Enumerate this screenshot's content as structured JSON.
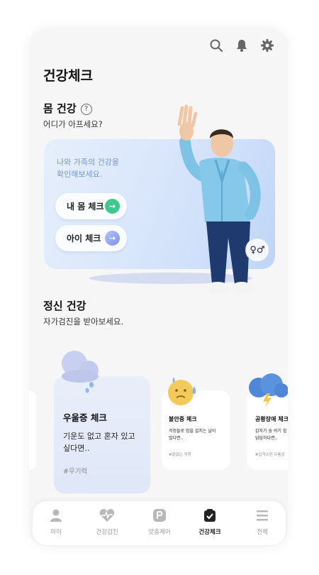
{
  "header": {
    "title": "건강체크",
    "icons": [
      "search-icon",
      "bell-icon",
      "gear-icon"
    ]
  },
  "body_health": {
    "title": "몸 건강",
    "help": "?",
    "subtitle": "어디가 아프세요?",
    "card_desc_line1": "나와 가족의 건강을",
    "card_desc_line2": "확인해보세요.",
    "my_check_label": "내 몸 체크",
    "child_check_label": "아이 체크",
    "arrow": "→",
    "gender_toggle": "♀♂"
  },
  "mental_health": {
    "title": "정신 건강",
    "subtitle": "자가검진을 받아보세요.",
    "cards": [
      {
        "title": "우울증 체크",
        "desc1": "기운도 없고 혼자 있고",
        "desc2": "싶다면..",
        "tag": "#무기력",
        "icon": "rain-cloud-icon"
      },
      {
        "title": "불안증 체크",
        "desc1": "걱정들로 밤을 설치는 날이",
        "desc2": "많다면..",
        "tag": "#끝없는 걱정",
        "icon": "worried-face-icon"
      },
      {
        "title": "공황장애 체크",
        "desc1": "갑자기 숨 쉬기 힘",
        "desc2": "답답하다면..",
        "tag": "#갑작스런 두통감",
        "icon": "storm-cloud-icon"
      }
    ]
  },
  "tabbar": {
    "items": [
      {
        "label": "마이",
        "icon": "person-icon"
      },
      {
        "label": "건강검진",
        "icon": "heart-pulse-icon"
      },
      {
        "label": "맞춤케어",
        "icon": "care-icon"
      },
      {
        "label": "건강체크",
        "icon": "clipboard-check-icon",
        "active": true
      },
      {
        "label": "전체",
        "icon": "menu-icon"
      }
    ]
  },
  "colors": {
    "accent_green": "#3ec98e",
    "accent_purple": "#8e9cf0",
    "card_text_blue": "#7a95d8"
  }
}
